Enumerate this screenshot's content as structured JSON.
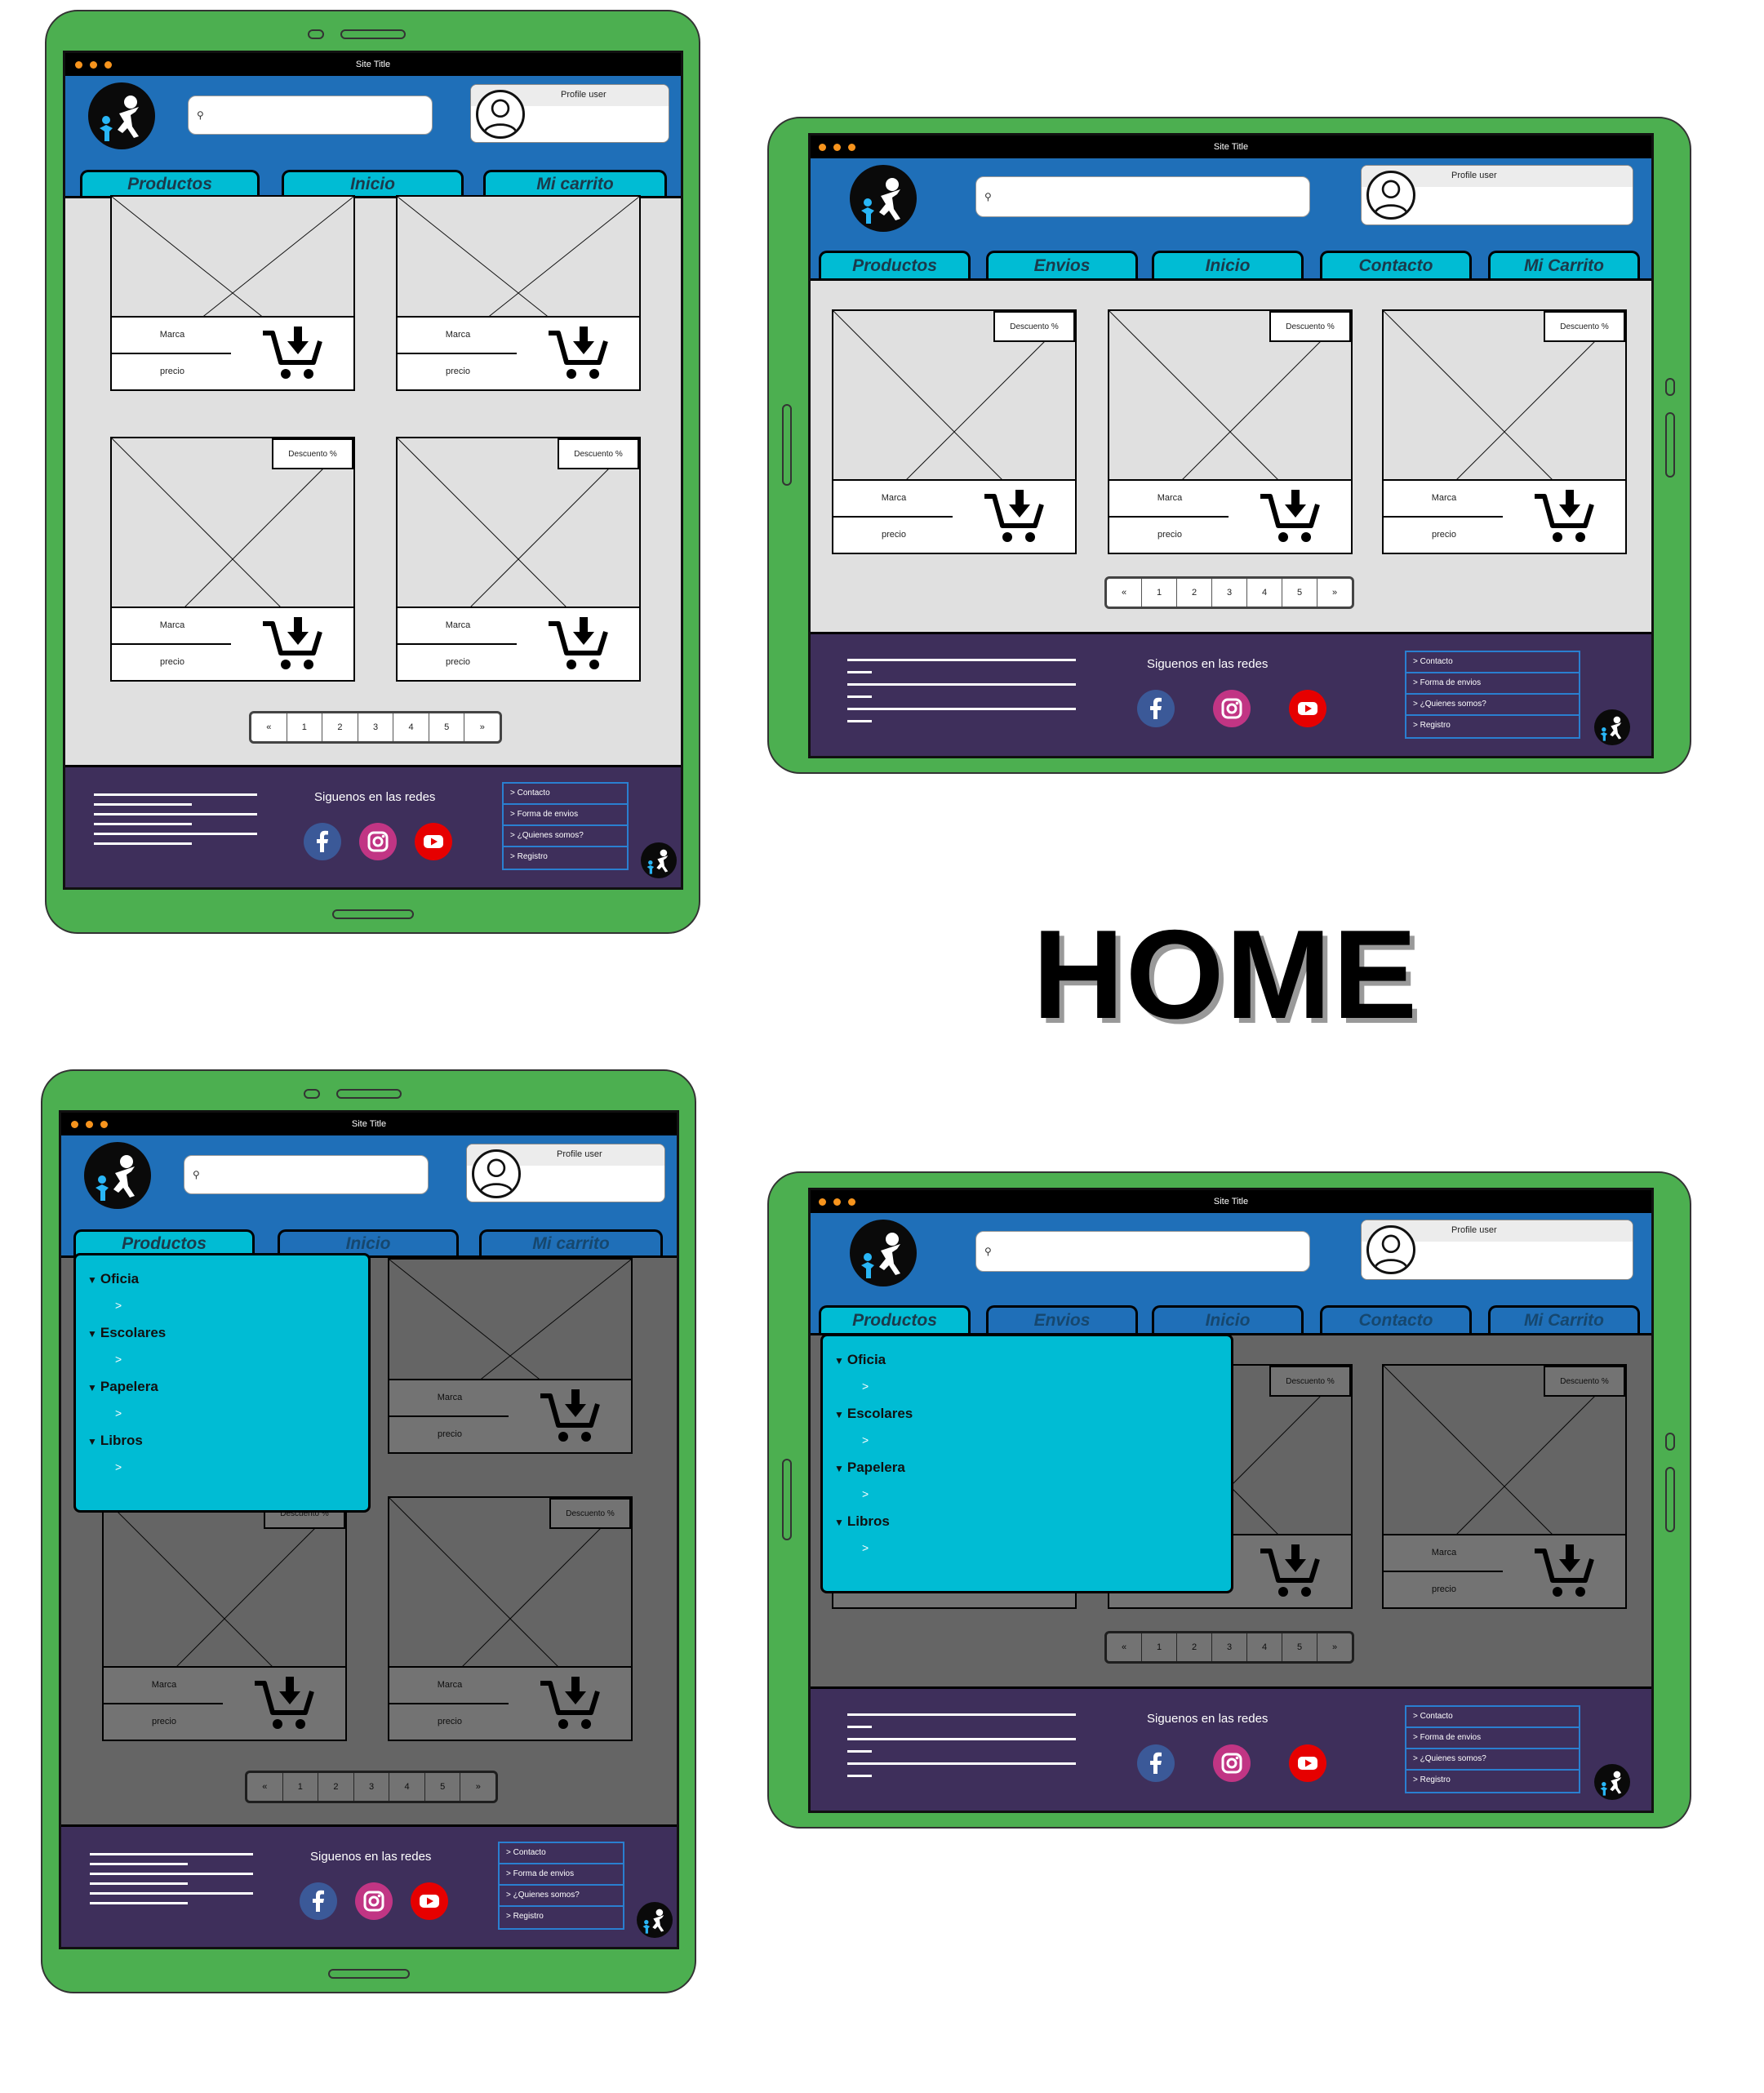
{
  "page_title": "HOME",
  "window": {
    "title": "Site Title"
  },
  "header": {
    "profile_label": "Profile user",
    "search_placeholder": ""
  },
  "nav_portrait": [
    "Productos",
    "Inicio",
    "Mi carrito"
  ],
  "nav_landscape": [
    "Productos",
    "Envios",
    "Inicio",
    "Contacto",
    "Mi Carrito"
  ],
  "product": {
    "brand": "Marca",
    "price": "precio",
    "discount": "Descuento %"
  },
  "pagination": [
    "«",
    "1",
    "2",
    "3",
    "4",
    "5",
    "»"
  ],
  "footer": {
    "follow_text": "Siguenos en las redes",
    "links": [
      "> Contacto",
      "> Forma de envios",
      "> ¿Quienes somos?",
      "> Registro"
    ],
    "social": [
      "facebook-icon",
      "instagram-icon",
      "youtube-icon"
    ]
  },
  "dropdown": {
    "categories": [
      {
        "label": "Oficia",
        "sub": ">"
      },
      {
        "label": "Escolares",
        "sub": ">"
      },
      {
        "label": "Papelera",
        "sub": ">"
      },
      {
        "label": "Libros",
        "sub": ">"
      }
    ]
  },
  "colors": {
    "device": "#4caf50",
    "header": "#1f6fb8",
    "tab": "#00bcd4",
    "footer": "#3e2f5b",
    "titlebar_dots": "#f7941d",
    "facebook": "#3b5998",
    "instagram": "#c13584",
    "youtube": "#e60000"
  }
}
